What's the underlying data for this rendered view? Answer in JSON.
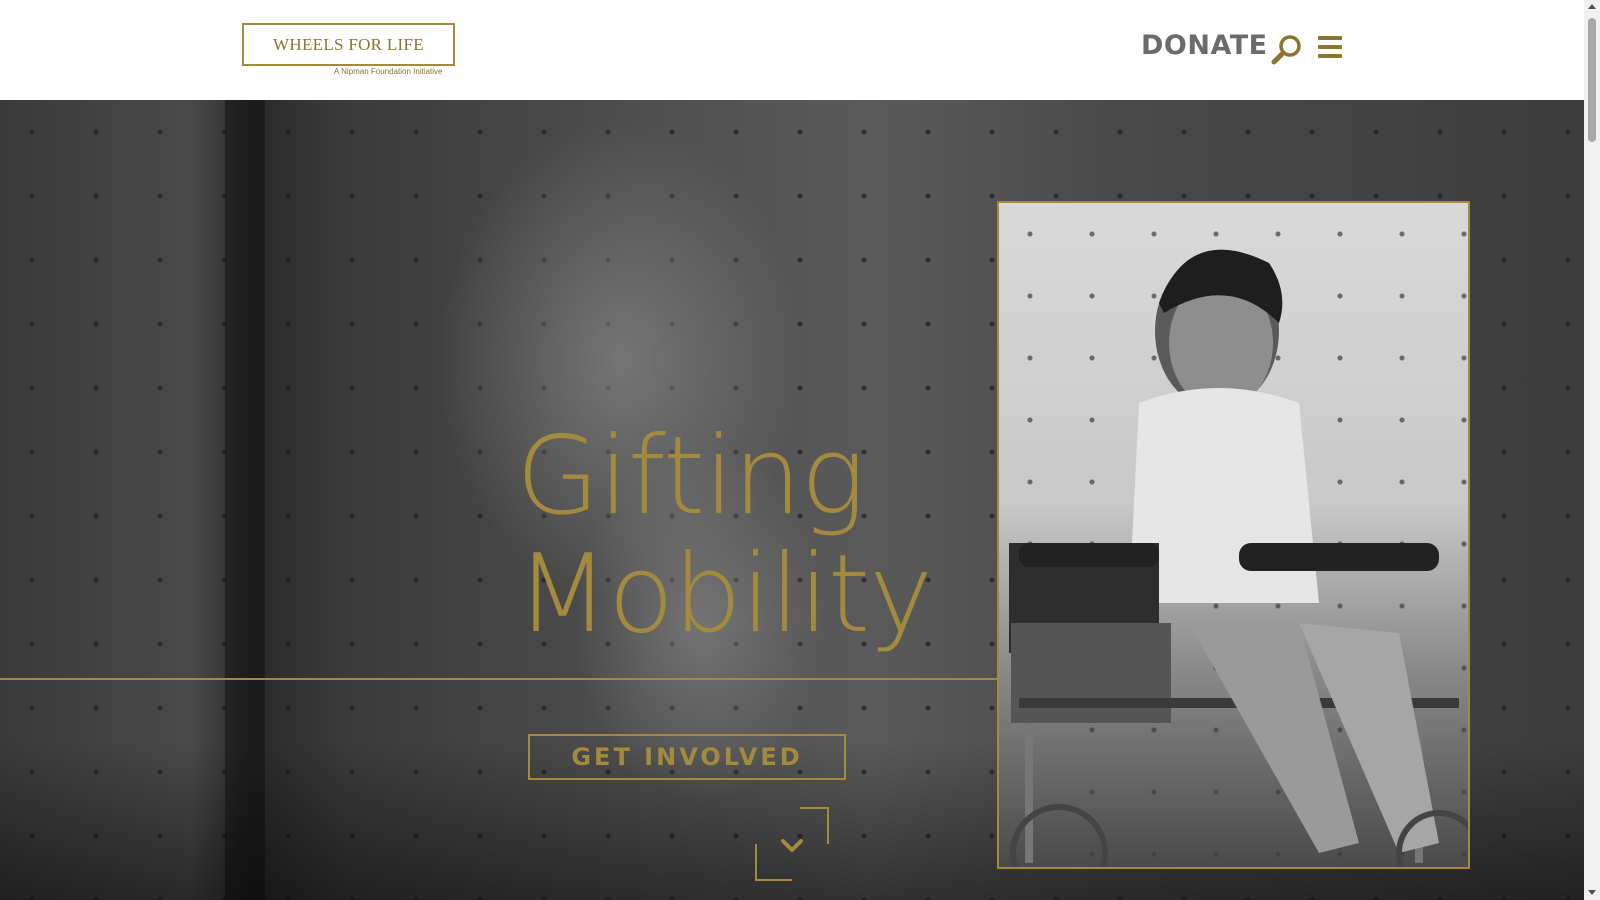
{
  "header": {
    "logo_text": "WHEELS FOR LIFE",
    "logo_subtitle": "A Nipman Foundation Initiative",
    "donate_label": "DONATE",
    "search_icon": "search-icon",
    "menu_icon": "hamburger-menu-icon"
  },
  "hero": {
    "title_line1": "Gifting",
    "title_line2": "Mobility",
    "cta_label": "GET INVOLVED",
    "scroll_icon": "chevron-down-icon"
  },
  "colors": {
    "accent_gold": "#a48a3f",
    "donate_gray": "#6b6b6b",
    "header_bg": "#ffffff"
  }
}
